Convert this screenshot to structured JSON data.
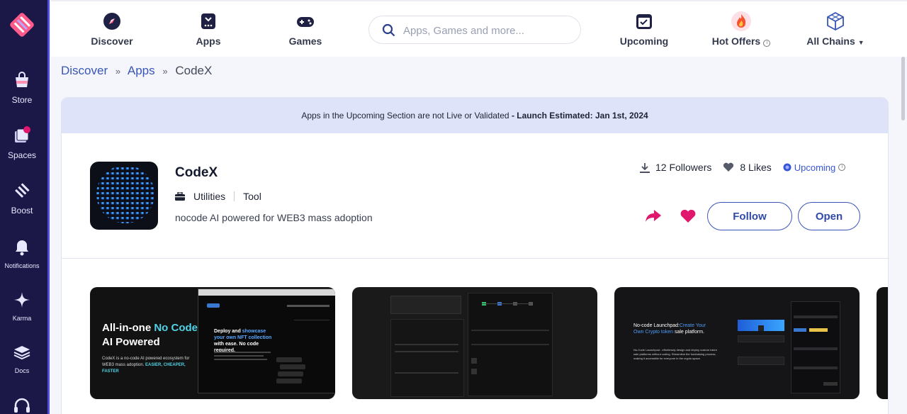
{
  "sidebar": {
    "items": [
      {
        "label": "Store",
        "icon": "store-bag-icon"
      },
      {
        "label": "Spaces",
        "icon": "spaces-icon"
      },
      {
        "label": "Boost",
        "icon": "boost-icon"
      },
      {
        "label": "Notifications",
        "icon": "bell-icon"
      },
      {
        "label": "Karma",
        "icon": "sparkle-icon"
      },
      {
        "label": "Docs",
        "icon": "docs-stack-icon"
      }
    ]
  },
  "nav": {
    "discover": "Discover",
    "apps": "Apps",
    "games": "Games",
    "search_placeholder": "Apps, Games and more...",
    "upcoming": "Upcoming",
    "hot_offers": "Hot Offers",
    "all_chains": "All Chains"
  },
  "breadcrumb": {
    "discover": "Discover",
    "apps": "Apps",
    "current": "CodeX",
    "sep": "»"
  },
  "banner": {
    "text": "Apps in the Upcoming Section are not Live or Validated",
    "strong": "- Launch Estimated: Jan 1st, 2024"
  },
  "app": {
    "name": "CodeX",
    "category": "Utilities",
    "subcategory": "Tool",
    "description": "nocode AI powered for WEB3 mass adoption",
    "followers": "12 Followers",
    "likes": "8 Likes",
    "status": "Upcoming",
    "follow_label": "Follow",
    "open_label": "Open"
  },
  "screens": {
    "s1_line1": "All-in-one",
    "s1_acc1": "No",
    "s1_acc2": "Code",
    "s1_line2": "AI Powered",
    "s1_small": "CodeX is a no-code AI powered ecosystem for WEB3 mass adoption.",
    "s1_small_acc": "EASIER, CHEAPER, FASTER",
    "s1_deploy1": "Deploy and",
    "s1_deploy_acc1": "showcase your own NFT collection",
    "s1_deploy2": "with ease. No code required.",
    "s3_text1": "No-code Launchpad:",
    "s3_acc": "Create Your Own Crypto token",
    "s3_text2": "sale platform.",
    "s3_sub": "No-Code Launchpad - effortlessly design and deploy custom token sale platforms without coding. Streamline the fundraising process, making it accessible for everyone in the crypto space."
  },
  "colors": {
    "sidebar_bg": "#1b1747",
    "accent": "#3956b6",
    "heart": "#e0176d",
    "banner_bg": "#dfe3fa"
  }
}
